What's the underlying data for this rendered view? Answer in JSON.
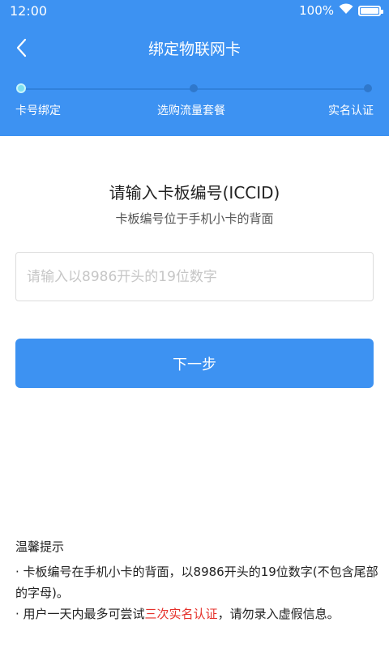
{
  "status_bar": {
    "time": "12:00",
    "battery_text": "100%"
  },
  "header": {
    "title": "绑定物联网卡"
  },
  "steps": [
    {
      "label": "卡号绑定",
      "active": true
    },
    {
      "label": "选购流量套餐",
      "active": false
    },
    {
      "label": "实名认证",
      "active": false
    }
  ],
  "form": {
    "title": "请输入卡板编号(ICCID)",
    "subtitle": "卡板编号位于手机小卡的背面",
    "iccid_placeholder": "请输入以8986开头的19位数字",
    "next_label": "下一步"
  },
  "tips": {
    "title": "温馨提示",
    "item1": "·  卡板编号在手机小卡的背面，以8986开头的19位数字(不包含尾部的字母)。",
    "item2_prefix": "·  用户一天内最多可尝试",
    "item2_highlight": "三次实名认证",
    "item2_suffix": "，请勿录入虚假信息。"
  },
  "colors": {
    "primary": "#3d92f2",
    "highlight": "#e5312b"
  }
}
